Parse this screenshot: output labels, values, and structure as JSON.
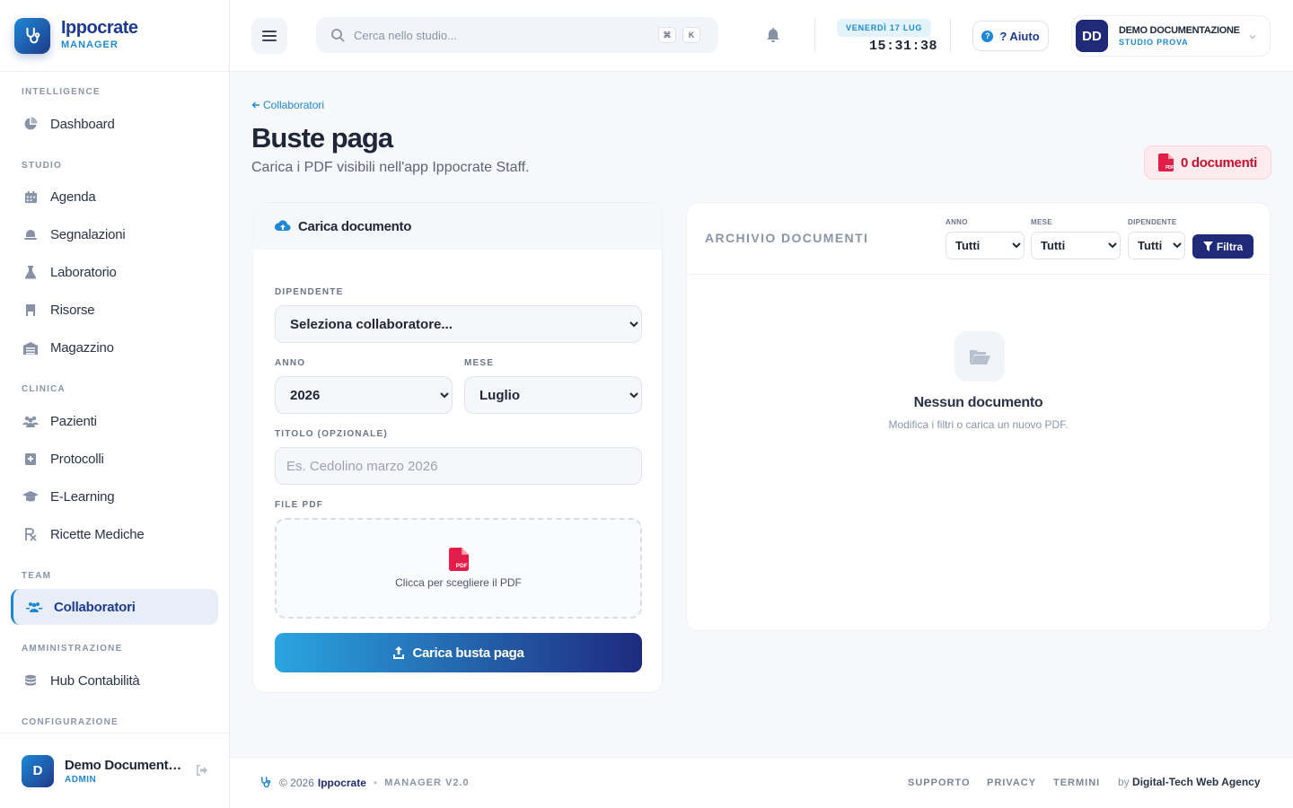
{
  "brand": {
    "name": "Ippocrate",
    "sub": "MANAGER"
  },
  "sidebar": {
    "sections": {
      "intelligence": "INTELLIGENCE",
      "studio": "STUDIO",
      "clinica": "CLINICA",
      "team": "TEAM",
      "amministrazione": "AMMINISTRAZIONE",
      "configurazione": "CONFIGURAZIONE"
    },
    "items": {
      "dashboard": "Dashboard",
      "agenda": "Agenda",
      "segnalazioni": "Segnalazioni",
      "laboratorio": "Laboratorio",
      "risorse": "Risorse",
      "magazzino": "Magazzino",
      "pazienti": "Pazienti",
      "protocolli": "Protocolli",
      "elearning": "E-Learning",
      "ricette": "Ricette Mediche",
      "collaboratori": "Collaboratori",
      "hub": "Hub Contabilità"
    },
    "user": {
      "initial": "D",
      "name": "Demo Documentazione",
      "role": "ADMIN"
    }
  },
  "topbar": {
    "search_placeholder": "Cerca nello studio...",
    "kbd1": "⌘",
    "kbd2": "K",
    "date": "VENERDÌ 17 LUG",
    "time": "15:31:38",
    "help": "? Aiuto",
    "user": {
      "initials": "DD",
      "name": "DEMO DOCUMENTAZIONE",
      "studio": "STUDIO PROVA"
    }
  },
  "page": {
    "back": "Collaboratori",
    "title": "Buste paga",
    "subtitle": "Carica i PDF visibili nell'app Ippocrate Staff.",
    "doc_count": "0 documenti"
  },
  "upload": {
    "header": "Carica documento",
    "dipendente_label": "DIPENDENTE",
    "dipendente_value": "Seleziona collaboratore...",
    "anno_label": "ANNO",
    "anno_value": "2026",
    "mese_label": "MESE",
    "mese_value": "Luglio",
    "titolo_label": "TITOLO (OPZIONALE)",
    "titolo_placeholder": "Es. Cedolino marzo 2026",
    "file_label": "FILE PDF",
    "dropzone_text": "Clicca per scegliere il PDF",
    "button": "Carica busta paga"
  },
  "archive": {
    "title": "ARCHIVIO DOCUMENTI",
    "anno_label": "ANNO",
    "anno_value": "Tutti",
    "mese_label": "MESE",
    "mese_value": "Tutti",
    "dip_label": "DIPENDENTE",
    "dip_value": "Tutti",
    "filter_btn": "Filtra",
    "empty_title": "Nessun documento",
    "empty_sub": "Modifica i filtri o carica un nuovo PDF."
  },
  "footer": {
    "copyright": "© 2026",
    "brand": "Ippocrate",
    "version": "MANAGER V2.0",
    "supporto": "SUPPORTO",
    "privacy": "PRIVACY",
    "termini": "TERMINI",
    "by": "by",
    "agency": "Digital-Tech Web Agency"
  },
  "colors": {
    "primary": "#1f2a78",
    "accent": "#1e88d6",
    "danger": "#c8102e"
  },
  "icons": [
    "stethoscope-icon",
    "pie-chart-icon",
    "calendar-icon",
    "alert-icon",
    "flask-icon",
    "bookmark-icon",
    "warehouse-icon",
    "users-icon",
    "protocol-icon",
    "graduation-cap-icon",
    "prescription-icon",
    "team-icon",
    "coins-icon",
    "logout-icon",
    "menu-icon",
    "search-icon",
    "bell-icon",
    "chevron-down-icon",
    "arrow-left-icon",
    "pdf-icon",
    "cloud-upload-icon",
    "upload-icon",
    "filter-icon",
    "folder-open-icon"
  ]
}
